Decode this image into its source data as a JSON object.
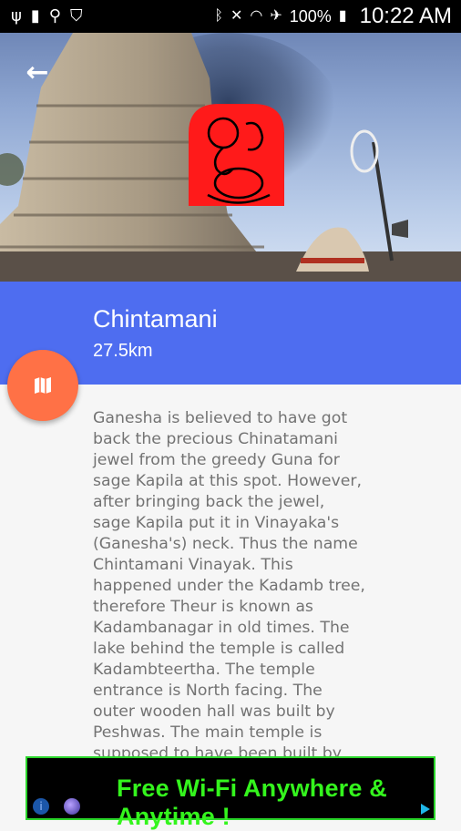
{
  "status_bar": {
    "battery_percent": "100%",
    "time": "10:22 AM"
  },
  "place": {
    "title": "Chintamani",
    "distance": "27.5km",
    "description": "Ganesha is believed to have got back the precious Chinatamani jewel from the greedy Guna for sage Kapila at this spot. However, after bringing back the jewel, sage Kapila put it in Vinayaka's (Ganesha's) neck. Thus the name Chintamani Vinayak. This happened under the Kadamb tree, therefore Theur is known as Kadambanagar in old times. The lake behind the temple is called Kadambteertha. The temple entrance is North facing. The outer wooden hall was built by Peshwas. The main temple is supposed to have been built by"
  },
  "ad": {
    "text": "Free Wi-Fi Anywhere & Anytime !"
  },
  "colors": {
    "header_band": "#4e6df0",
    "fab": "#ff7146",
    "ganesh_symbol": "#ff1a1a"
  }
}
